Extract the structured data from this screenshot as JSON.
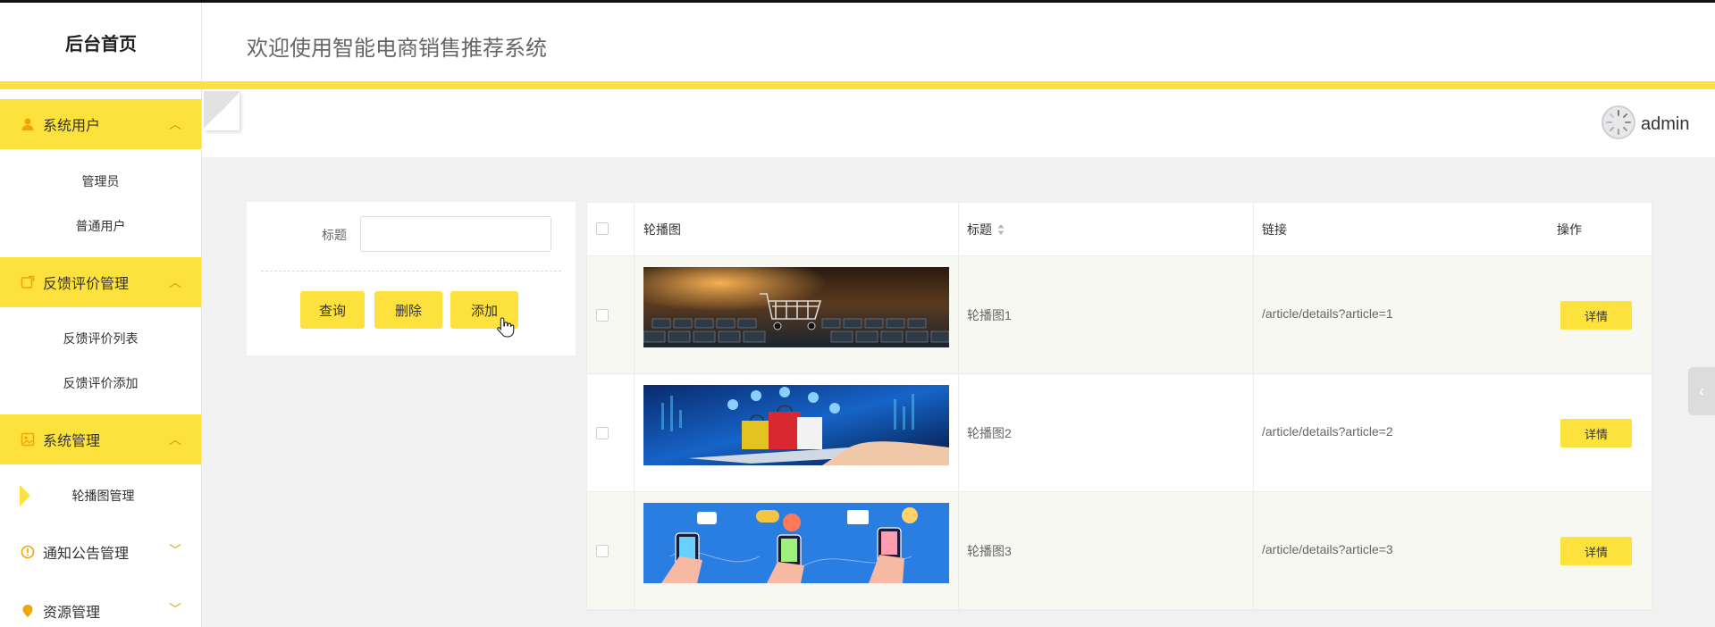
{
  "header": {
    "brand": "后台首页",
    "welcome": "欢迎使用智能电商销售推荐系统"
  },
  "user": {
    "name": "admin"
  },
  "sidebar": {
    "groups": [
      {
        "label": "系统用户",
        "icon": "user-icon",
        "expanded": true,
        "items": [
          "管理员",
          "普通用户"
        ]
      },
      {
        "label": "反馈评价管理",
        "icon": "feedback-icon",
        "expanded": true,
        "items": [
          "反馈评价列表",
          "反馈评价添加"
        ]
      },
      {
        "label": "系统管理",
        "icon": "settings-icon",
        "expanded": true,
        "items": [
          "轮播图管理"
        ]
      },
      {
        "label": "通知公告管理",
        "icon": "notice-icon",
        "expanded": false,
        "items": []
      },
      {
        "label": "资源管理",
        "icon": "resource-icon",
        "expanded": false,
        "items": []
      }
    ],
    "active_item": "轮播图管理"
  },
  "search": {
    "label": "标题",
    "value": "",
    "placeholder": ""
  },
  "buttons": {
    "query": "查询",
    "delete": "删除",
    "add": "添加"
  },
  "table": {
    "columns": [
      "轮播图",
      "标题",
      "链接",
      "操作"
    ],
    "rows": [
      {
        "image": "shopping-cart-on-keyboard-image",
        "title": "轮播图1",
        "link": "/article/details?article=1",
        "action": "详情"
      },
      {
        "image": "shopping-bags-on-tablet-image",
        "title": "轮播图2",
        "link": "/article/details?article=2",
        "action": "详情"
      },
      {
        "image": "hands-with-phones-shopping-image",
        "title": "轮播图3",
        "link": "/article/details?article=3",
        "action": "详情"
      }
    ]
  },
  "colors": {
    "accent": "#fde23d",
    "background": "#f1f1f1"
  }
}
